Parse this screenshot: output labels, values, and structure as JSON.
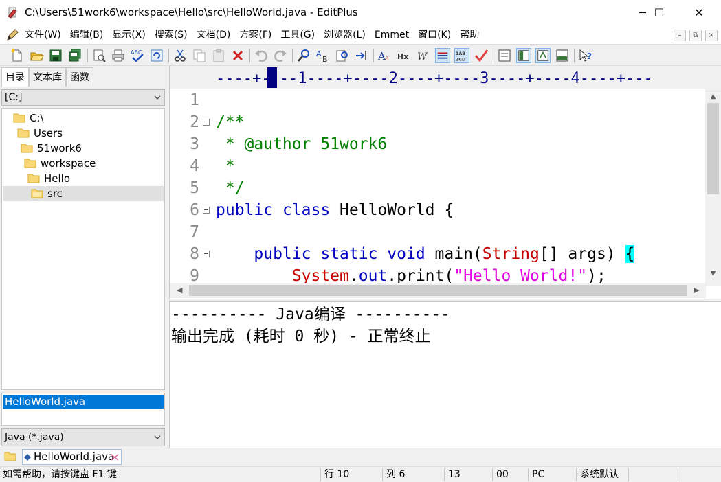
{
  "window": {
    "title": "C:\\Users\\51work6\\workspace\\Hello\\src\\HelloWorld.java - EditPlus",
    "minimize": "─",
    "maximize": "☐",
    "close": "✕"
  },
  "menu": {
    "items": [
      "文件(W)",
      "编辑(B)",
      "显示(X)",
      "搜索(S)",
      "文档(D)",
      "方案(F)",
      "工具(G)",
      "浏览器(L)",
      "Emmet",
      "窗口(K)",
      "帮助"
    ],
    "mdi": [
      "–",
      "⧉",
      "×"
    ]
  },
  "toolbar": {
    "icons": [
      "new-file-icon",
      "open-folder-icon",
      "save-icon",
      "save-all-icon",
      "print-preview-icon",
      "print-icon",
      "spell-check-icon",
      "toggle-icon",
      "cut-icon",
      "copy-icon",
      "paste-icon",
      "delete-icon",
      "undo-icon",
      "redo-icon",
      "find-icon",
      "replace-icon",
      "find-in-files-icon",
      "goto-icon",
      "font-icon",
      "hex-icon",
      "word-wrap-icon",
      "indent-icon",
      "line-number-icon",
      "check-icon",
      "cliptext-icon",
      "directory-icon",
      "browser-icon",
      "output-icon",
      "help-icon"
    ]
  },
  "sidebar": {
    "tabs": [
      "目录",
      "文本库",
      "函数"
    ],
    "drive": "[C:]",
    "tree": [
      {
        "label": "C:\\",
        "indent": 0
      },
      {
        "label": "Users",
        "indent": 1
      },
      {
        "label": "51work6",
        "indent": 2
      },
      {
        "label": "workspace",
        "indent": 3
      },
      {
        "label": "Hello",
        "indent": 4
      },
      {
        "label": "src",
        "indent": 5,
        "selected": true
      }
    ],
    "files": [
      "HelloWorld.java"
    ],
    "filter": "Java (*.java)"
  },
  "editor": {
    "ruler": "----+----1----+----2----+----3----+----4----+---",
    "lines": [
      {
        "n": "1",
        "fold": false,
        "tokens": []
      },
      {
        "n": "2",
        "fold": true,
        "tokens": [
          {
            "t": "/**",
            "c": "cmt"
          }
        ]
      },
      {
        "n": "3",
        "fold": false,
        "tokens": [
          {
            "t": " * @author 51work6",
            "c": "cmt"
          }
        ]
      },
      {
        "n": "4",
        "fold": false,
        "tokens": [
          {
            "t": " *",
            "c": "cmt"
          }
        ]
      },
      {
        "n": "5",
        "fold": false,
        "tokens": [
          {
            "t": " */",
            "c": "cmt"
          }
        ]
      },
      {
        "n": "6",
        "fold": true,
        "tokens": [
          {
            "t": "public",
            "c": "kw"
          },
          {
            "t": " ",
            "c": ""
          },
          {
            "t": "class",
            "c": "kw"
          },
          {
            "t": " HelloWorld {",
            "c": ""
          }
        ]
      },
      {
        "n": "7",
        "fold": false,
        "tokens": []
      },
      {
        "n": "8",
        "fold": true,
        "tokens": [
          {
            "t": "    ",
            "c": ""
          },
          {
            "t": "public",
            "c": "kw"
          },
          {
            "t": " ",
            "c": ""
          },
          {
            "t": "static",
            "c": "kw"
          },
          {
            "t": " ",
            "c": ""
          },
          {
            "t": "void",
            "c": "kw"
          },
          {
            "t": " main(",
            "c": ""
          },
          {
            "t": "String",
            "c": "type"
          },
          {
            "t": "[] args) ",
            "c": ""
          },
          {
            "t": "{",
            "c": "brace"
          }
        ]
      },
      {
        "n": "9",
        "fold": false,
        "tokens": [
          {
            "t": "        ",
            "c": ""
          },
          {
            "t": "System",
            "c": "type"
          },
          {
            "t": ".",
            "c": ""
          },
          {
            "t": "out",
            "c": "kw"
          },
          {
            "t": ".print(",
            "c": ""
          },
          {
            "t": "\"Hello World!\"",
            "c": "str"
          },
          {
            "t": ");",
            "c": ""
          }
        ]
      }
    ]
  },
  "output": {
    "lines": [
      "---------- Java编译 ----------",
      "输出完成 (耗时 0 秒) - 正常终止"
    ]
  },
  "document_tab": "HelloWorld.java",
  "status": {
    "help": "如需帮助，请按键盘 F1 键",
    "line": "行 10",
    "col": "列 6",
    "num": "13",
    "code": "00",
    "mode": "PC",
    "encoding": "系统默认"
  }
}
